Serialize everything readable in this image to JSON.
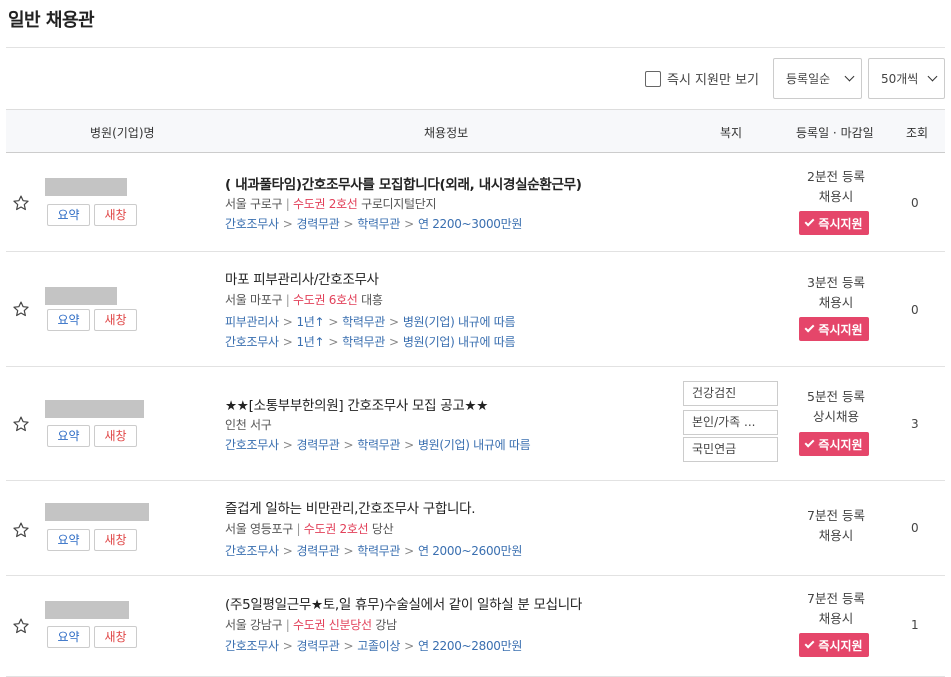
{
  "page": {
    "title": "일반 채용관"
  },
  "filters": {
    "instant_only_label": "즉시 지원만 보기",
    "sort_selected": "등록일순",
    "count_selected": "50개씩"
  },
  "table": {
    "headers": {
      "company": "병원(기업)명",
      "info": "채용정보",
      "welfare": "복지",
      "date": "등록일 · 마감일",
      "views": "조회"
    }
  },
  "labels": {
    "summary": "요약",
    "new_window": "새창",
    "apply": "즉시지원"
  },
  "colors": {
    "accent": "#e5466a",
    "subway": "#e2415a",
    "link": "#3a6fb0"
  },
  "rows": [
    {
      "title": "( 내과풀타임)간호조무사를 모집합니다(외래, 내시경실순환근무)",
      "loc": {
        "area": "서울 구로구",
        "sep": "|",
        "subway": "수도권 2호선",
        "station": "구로디지털단지"
      },
      "conds": [
        [
          "간호조무사",
          "경력무관",
          "학력무관",
          "연 2200~3000만원"
        ]
      ],
      "welfare": [],
      "posted": "2분전 등록",
      "deadline": "채용시",
      "instant": true,
      "views": "0"
    },
    {
      "title": "마포 피부관리사/간호조무사",
      "loc": {
        "area": "서울 마포구",
        "sep": "|",
        "subway": "수도권 6호선",
        "station": "대흥"
      },
      "conds": [
        [
          "피부관리사",
          "1년↑",
          "학력무관",
          "병원(기업) 내규에 따름"
        ],
        [
          "간호조무사",
          "1년↑",
          "학력무관",
          "병원(기업) 내규에 따름"
        ]
      ],
      "welfare": [],
      "posted": "3분전 등록",
      "deadline": "채용시",
      "instant": true,
      "views": "0"
    },
    {
      "title": "★★[소통부부한의원] 간호조무사 모집 공고★★",
      "loc": {
        "area": "인천 서구",
        "sep": "",
        "subway": "",
        "station": ""
      },
      "conds": [
        [
          "간호조무사",
          "경력무관",
          "학력무관",
          "병원(기업) 내규에 따름"
        ]
      ],
      "welfare": [
        "건강검진",
        "본인/가족 ...",
        "국민연금"
      ],
      "posted": "5분전 등록",
      "deadline": "상시채용",
      "instant": true,
      "views": "3"
    },
    {
      "title": "즐겁게 일하는 비만관리,간호조무사 구합니다.",
      "loc": {
        "area": "서울 영등포구",
        "sep": "|",
        "subway": "수도권 2호선",
        "station": "당산"
      },
      "conds": [
        [
          "간호조무사",
          "경력무관",
          "학력무관",
          "연 2000~2600만원"
        ]
      ],
      "welfare": [],
      "posted": "7분전 등록",
      "deadline": "채용시",
      "instant": false,
      "views": "0"
    },
    {
      "title": "(주5일평일근무★토,일 휴무)수술실에서 같이 일하실 분 모십니다",
      "loc": {
        "area": "서울 강남구",
        "sep": "|",
        "subway": "수도권 신분당선",
        "station": "강남"
      },
      "conds": [
        [
          "간호조무사",
          "경력무관",
          "고졸이상",
          "연 2200~2800만원"
        ]
      ],
      "welfare": [],
      "posted": "7분전 등록",
      "deadline": "채용시",
      "instant": true,
      "views": "1"
    }
  ]
}
